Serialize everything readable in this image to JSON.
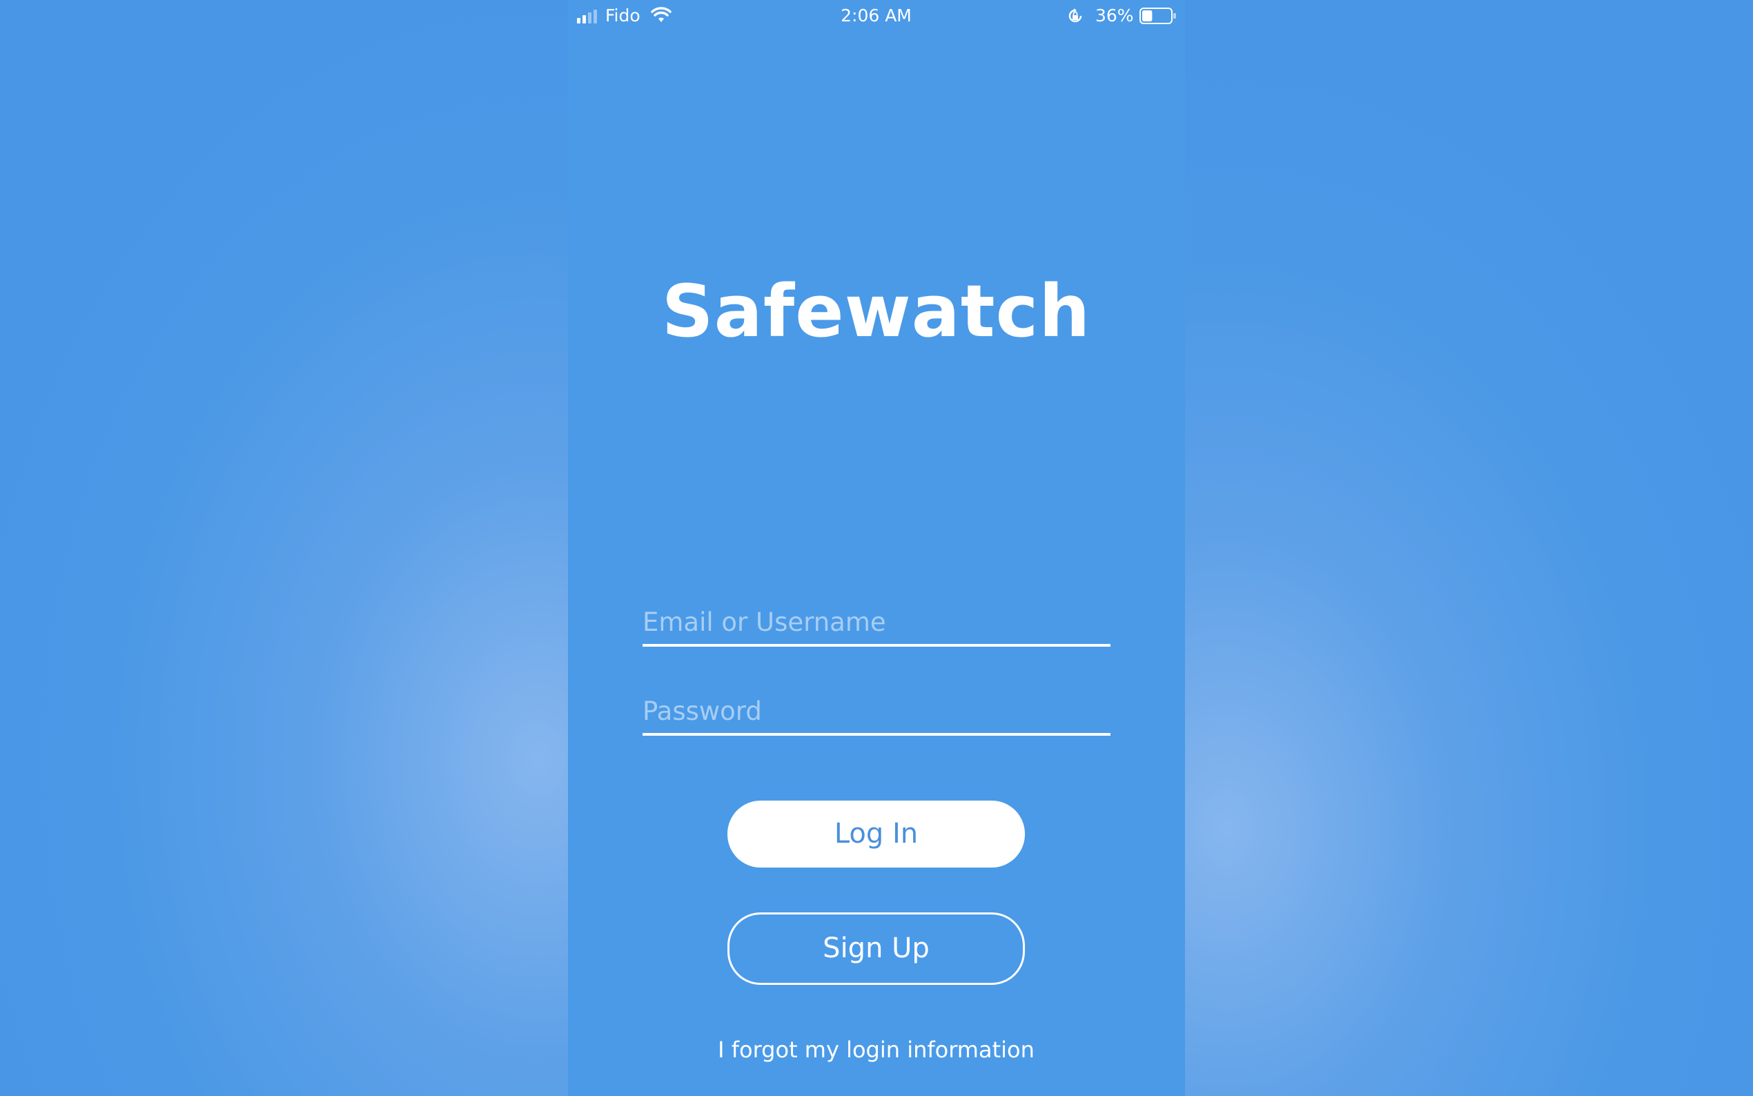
{
  "status_bar": {
    "carrier": "Fido",
    "time": "2:06 AM",
    "battery_percent": "36%",
    "battery_level": 0.36,
    "icons": [
      "signal-icon",
      "wifi-icon",
      "orientation-lock-icon",
      "battery-icon"
    ]
  },
  "app": {
    "title": "Safewatch"
  },
  "login_form": {
    "email_placeholder": "Email or Username",
    "email_value": "",
    "password_placeholder": "Password",
    "password_value": "",
    "login_label": "Log In",
    "signup_label": "Sign Up",
    "forgot_label": "I forgot my login information"
  },
  "colors": {
    "background": "#4a9ae8",
    "text": "#ffffff",
    "login_button_text": "#4a90d9",
    "placeholder": "#a8cdf3"
  }
}
